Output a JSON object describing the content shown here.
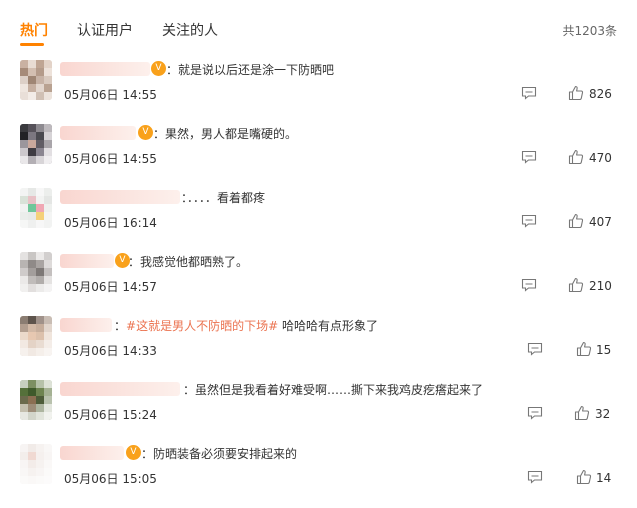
{
  "tabs": [
    {
      "label": "热门",
      "active": true
    },
    {
      "label": "认证用户",
      "active": false
    },
    {
      "label": "关注的人",
      "active": false
    }
  ],
  "total_label": "共1203条",
  "accent_color": "#ff8200",
  "hashtag_color": "#eb7350",
  "comments": [
    {
      "text": "就是说以后还是涂一下防晒吧",
      "time": "05月06日 14:55",
      "likes": "826"
    },
    {
      "text": "果然，男人都是嘴硬的。",
      "time": "05月06日 14:55",
      "likes": "470"
    },
    {
      "text": "．．．．看着都疼",
      "time": "05月06日 16:14",
      "likes": "407"
    },
    {
      "text": "我感觉他都晒熟了。",
      "time": "05月06日 14:57",
      "likes": "210"
    },
    {
      "hashtag": "#这就是男人不防晒的下场#",
      "text": "哈哈哈有点形象了",
      "time": "05月06日 14:33",
      "likes": "15"
    },
    {
      "text": "虽然但是我看着好难受啊……撕下来我鸡皮疙瘩起来了",
      "time": "05月06日 15:24",
      "likes": "32"
    },
    {
      "text": "防晒装备必须要安排起来的",
      "time": "05月06日 15:05",
      "likes": "14"
    }
  ],
  "icons": {
    "reply": "comment-icon",
    "like": "thumbs-up-icon",
    "vip": "vip-badge-icon"
  }
}
